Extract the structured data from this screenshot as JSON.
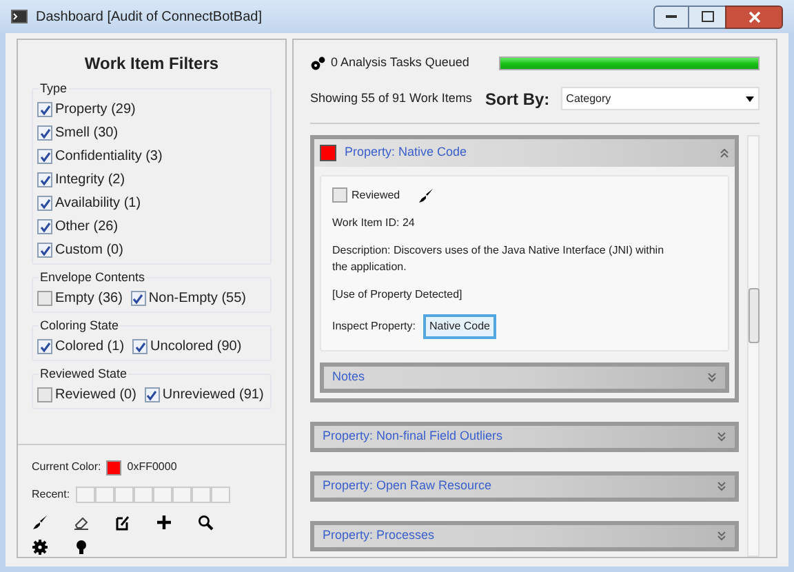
{
  "window": {
    "title": "Dashboard [Audit of ConnectBotBad]"
  },
  "filters": {
    "title": "Work Item Filters",
    "groups": [
      {
        "label": "Type",
        "kind": "column",
        "items": [
          {
            "label": "Property (29)",
            "checked": true
          },
          {
            "label": "Smell (30)",
            "checked": true
          },
          {
            "label": "Confidentiality (3)",
            "checked": true
          },
          {
            "label": "Integrity (2)",
            "checked": true
          },
          {
            "label": "Availability (1)",
            "checked": true
          },
          {
            "label": "Other (26)",
            "checked": true
          },
          {
            "label": "Custom (0)",
            "checked": true
          }
        ]
      },
      {
        "label": "Envelope Contents",
        "kind": "row",
        "items": [
          {
            "label": "Empty (36)",
            "checked": false
          },
          {
            "label": "Non-Empty (55)",
            "checked": true
          }
        ]
      },
      {
        "label": "Coloring State",
        "kind": "row",
        "items": [
          {
            "label": "Colored (1)",
            "checked": true
          },
          {
            "label": "Uncolored (90)",
            "checked": true
          }
        ]
      },
      {
        "label": "Reviewed State",
        "kind": "row",
        "items": [
          {
            "label": "Reviewed (0)",
            "checked": false
          },
          {
            "label": "Unreviewed (91)",
            "checked": true
          }
        ]
      }
    ]
  },
  "color_panel": {
    "label": "Current Color:",
    "color": "#ff0000",
    "value": "0xFF0000",
    "recent_label": "Recent:"
  },
  "header": {
    "tasks": "0 Analysis Tasks Queued",
    "level": 1,
    "showing": "Showing 55 of 91 Work Items",
    "sort_label": "Sort By:",
    "sort_value": "Category"
  },
  "items": [
    {
      "title": "Property: Native Code",
      "expanded": true,
      "color": "#ff0000",
      "reviewed_label": "Reviewed",
      "reviewed": false,
      "id_text": "Work Item ID: 24",
      "description": "Description: Discovers uses of the Java Native Interface (JNI) within the application.",
      "detected": "[Use of Property Detected]",
      "inspect_label": "Inspect Property:",
      "inspect_value": "Native Code",
      "notes": {
        "title": "Notes",
        "expanded": false
      }
    },
    {
      "title": "Property: Non-final Field Outliers",
      "expanded": false
    },
    {
      "title": "Property: Open Raw Resource",
      "expanded": false
    },
    {
      "title": "Property: Processes",
      "expanded": false
    }
  ]
}
